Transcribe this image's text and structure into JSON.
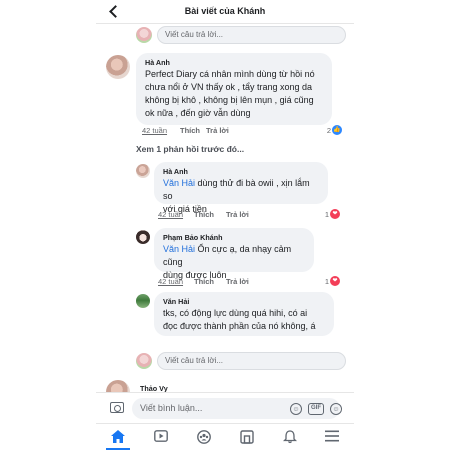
{
  "header": {
    "title": "Bài viết của Khánh"
  },
  "reply_placeholder": "Viết câu trả lời...",
  "comments": [
    {
      "author": "Hà Anh",
      "mention": "",
      "lines": [
        "Perfect Diary cá nhân mình dùng từ hồi nó",
        "chưa nổi ở VN thấy ok , tẩy trang xong da",
        "không bị khô , không bị lên mụn , giá cũng",
        "ok nữa  , đến giờ vẫn dùng"
      ],
      "time": "42 tuần",
      "like": "Thích",
      "reply": "Trả lời",
      "reaction_count": "2",
      "reaction": "like"
    },
    {
      "author": "Hà Anh",
      "mention": "Văn Hải",
      "lines": [
        " dùng thử đi bà owii , xịn lắm so",
        "với giá tiền"
      ],
      "time": "42 tuần",
      "like": "Thích",
      "reply": "Trả lời",
      "reaction_count": "1",
      "reaction": "heart"
    },
    {
      "author": "Phạm Bảo Khánh",
      "mention": "Văn Hải",
      "lines": [
        " Ổn cực ạ, da nhạy cảm cũng",
        "dùng được luôn"
      ],
      "time": "42 tuần",
      "like": "Thích",
      "reply": "Trả lời",
      "reaction_count": "1",
      "reaction": "heart"
    },
    {
      "author": "Văn Hải",
      "mention": "",
      "lines": [
        "tks, có động lực dùng quá hihi, có ai",
        "đọc được thành phần của nó không, á"
      ],
      "time": "",
      "like": "",
      "reply": "",
      "reaction_count": "",
      "reaction": ""
    }
  ],
  "previous_replies": "Xem 1 phản hồi trước đó...",
  "partial_author": "Thảo Vy",
  "comment_bar": {
    "placeholder": "Viết bình luận...",
    "gif_label": "GIF"
  },
  "nav": [
    "home",
    "watch",
    "groups",
    "marketplace",
    "notifications",
    "menu"
  ]
}
